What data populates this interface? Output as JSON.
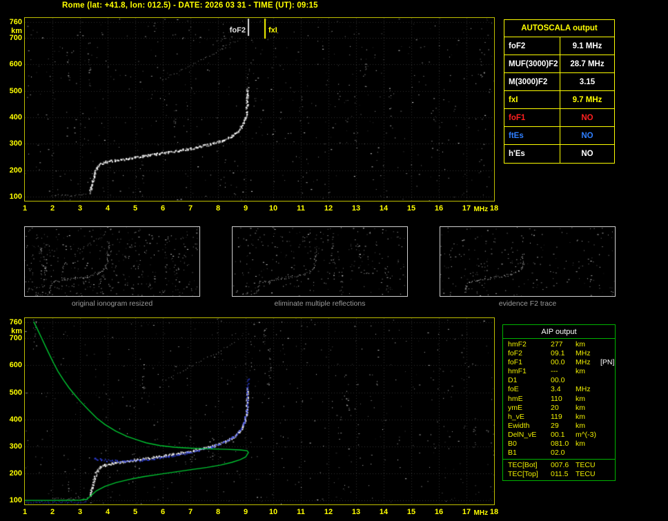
{
  "title": "Rome (lat: +41.8, lon: 012.5) - DATE: 2026 03 31 - TIME (UT): 09:15",
  "accents": {
    "title_color": "#ffff00",
    "ionogram_border": "#c0c000",
    "aip_border": "#00b400",
    "grid_color": "#343434",
    "trace_color": "#ffffff",
    "fitted_trace_color": "#3344ee",
    "profile_color": "#00c832"
  },
  "autoscala_table": {
    "header": "AUTOSCALA output",
    "rows": [
      {
        "label": "foF2",
        "value": "9.1 MHz",
        "color": "#ffffff"
      },
      {
        "label": "MUF(3000)F2",
        "value": "28.7 MHz",
        "color": "#ffffff"
      },
      {
        "label": "M(3000)F2",
        "value": "3.15",
        "color": "#ffffff"
      },
      {
        "label": "fxI",
        "value": "9.7 MHz",
        "color": "#ffff00"
      },
      {
        "label": "foF1",
        "value": "NO",
        "color": "#ff2020"
      },
      {
        "label": "ftEs",
        "value": "NO",
        "color": "#2f7fff"
      },
      {
        "label": "h'Es",
        "value": "NO",
        "color": "#ffffff"
      }
    ]
  },
  "aip_table": {
    "header": "AIP output",
    "rows": [
      {
        "label": "hmF2",
        "value": "277",
        "unit": "km",
        "extra": ""
      },
      {
        "label": "foF2",
        "value": "09.1",
        "unit": "MHz",
        "extra": ""
      },
      {
        "label": "foF1",
        "value": "00.0",
        "unit": "MHz",
        "extra": "[PN]"
      },
      {
        "label": "hmF1",
        "value": "---",
        "unit": "km",
        "extra": ""
      },
      {
        "label": "D1",
        "value": "00.0",
        "unit": "",
        "extra": ""
      },
      {
        "label": "foE",
        "value": "3.4",
        "unit": "MHz",
        "extra": ""
      },
      {
        "label": "hmE",
        "value": "110",
        "unit": "km",
        "extra": ""
      },
      {
        "label": "ymE",
        "value": "20",
        "unit": "km",
        "extra": ""
      },
      {
        "label": "h_vE",
        "value": "119",
        "unit": "km",
        "extra": ""
      },
      {
        "label": "Ewidth",
        "value": "29",
        "unit": "km",
        "extra": ""
      },
      {
        "label": "DelN_vE",
        "value": "00.1",
        "unit": "m^(-3)",
        "extra": ""
      },
      {
        "label": "B0",
        "value": "081.0",
        "unit": "km",
        "extra": ""
      },
      {
        "label": "B1",
        "value": "02.0",
        "unit": "",
        "extra": ""
      }
    ],
    "tec_rows": [
      {
        "label": "TEC[Bot]",
        "value": "007.6",
        "unit": "TECU",
        "extra": ""
      },
      {
        "label": "TEC[Top]",
        "value": "011.5",
        "unit": "TECU",
        "extra": ""
      }
    ]
  },
  "thumbnails": [
    {
      "caption": "original ionogram resized",
      "noise_count": 430,
      "streaks": 10,
      "series": [
        "E-trace",
        "F-trace",
        "second-hop",
        "x-tail"
      ]
    },
    {
      "caption": "eliminate multiple reflections",
      "noise_count": 270,
      "streaks": 7,
      "series": [
        "E-trace",
        "F-trace",
        "x-tail"
      ]
    },
    {
      "caption": "evidence F2 trace",
      "noise_count": 210,
      "streaks": 5,
      "series": [
        "F-trace"
      ]
    }
  ],
  "chart_data": [
    {
      "id": "scaled-ionogram",
      "type": "scatter",
      "title": "scaled ionogram with AUTOSCALA markers",
      "xlabel": "MHz",
      "ylabel": "km",
      "x_range": [
        1,
        18
      ],
      "y_range": [
        85,
        775
      ],
      "x_ticks": [
        1,
        2,
        3,
        4,
        5,
        6,
        7,
        8,
        9,
        10,
        11,
        12,
        13,
        14,
        15,
        16,
        17,
        18
      ],
      "y_ticks": [
        760,
        700,
        600,
        500,
        400,
        300,
        200,
        100
      ],
      "grid": true,
      "markers": [
        {
          "label": "foF2",
          "f": 9.1,
          "color": "#e0e0e0",
          "len": 26,
          "side": "left"
        },
        {
          "label": "fxI",
          "f": 9.7,
          "color": "#ffff00",
          "len": 30,
          "side": "right"
        }
      ],
      "noise": {
        "seed": 11,
        "count": 560,
        "streaks": 18
      },
      "series": [
        {
          "name": "E-trace",
          "color": "#c8c8c8",
          "size": 1,
          "density": 0.35,
          "points": [
            [
              2.0,
              107
            ],
            [
              2.5,
              106
            ],
            [
              3.0,
              108
            ],
            [
              3.3,
              112
            ]
          ]
        },
        {
          "name": "F-trace",
          "color": "#ffffff",
          "size": 2,
          "density": 0.9,
          "points": [
            [
              3.35,
              118
            ],
            [
              3.45,
              160
            ],
            [
              3.55,
              200
            ],
            [
              3.7,
              226
            ],
            [
              3.9,
              233
            ],
            [
              4.1,
              237
            ],
            [
              4.4,
              241
            ],
            [
              4.7,
              246
            ],
            [
              5.0,
              251
            ],
            [
              5.5,
              259
            ],
            [
              6.0,
              267
            ],
            [
              6.5,
              275
            ],
            [
              7.0,
              284
            ],
            [
              7.4,
              293
            ],
            [
              7.8,
              303
            ],
            [
              8.1,
              313
            ],
            [
              8.4,
              326
            ],
            [
              8.6,
              340
            ],
            [
              8.8,
              360
            ],
            [
              8.92,
              385
            ],
            [
              9.0,
              412
            ],
            [
              9.03,
              442
            ],
            [
              9.04,
              470
            ],
            [
              9.05,
              495
            ],
            [
              9.05,
              515
            ]
          ]
        },
        {
          "name": "second-hop",
          "color": "#b4b4b4",
          "size": 1,
          "density": 0.3,
          "points": [
            [
              6.0,
              545
            ],
            [
              6.4,
              565
            ],
            [
              6.8,
              586
            ],
            [
              7.2,
              608
            ],
            [
              7.6,
              630
            ],
            [
              8.0,
              652
            ],
            [
              8.3,
              670
            ],
            [
              8.6,
              688
            ],
            [
              8.8,
              700
            ]
          ]
        },
        {
          "name": "x-tail",
          "color": "#909090",
          "size": 1,
          "density": 0.2,
          "points": [
            [
              9.06,
              520
            ],
            [
              9.08,
              548
            ],
            [
              9.09,
              575
            ],
            [
              9.1,
              598
            ]
          ]
        }
      ]
    },
    {
      "id": "profile-ionogram",
      "type": "scatter",
      "title": "ionogram with fitted trace and electron density profile",
      "xlabel": "MHz",
      "ylabel": "km",
      "x_range": [
        1,
        18
      ],
      "y_range": [
        85,
        775
      ],
      "x_ticks": [
        1,
        2,
        3,
        4,
        5,
        6,
        7,
        8,
        9,
        10,
        11,
        12,
        13,
        14,
        15,
        16,
        17,
        18
      ],
      "y_ticks": [
        760,
        700,
        600,
        500,
        400,
        300,
        200,
        100
      ],
      "grid": true,
      "markers": [],
      "noise": {
        "seed": 29,
        "count": 500,
        "streaks": 15
      },
      "series": [
        {
          "name": "E-trace",
          "color": "#c8c8c8",
          "size": 1,
          "density": 0.35,
          "points": [
            [
              2.0,
              107
            ],
            [
              2.5,
              106
            ],
            [
              3.0,
              108
            ],
            [
              3.3,
              112
            ]
          ]
        },
        {
          "name": "F-trace",
          "color": "#ffffff",
          "size": 2,
          "density": 0.9,
          "points": [
            [
              3.35,
              118
            ],
            [
              3.45,
              160
            ],
            [
              3.55,
              200
            ],
            [
              3.7,
              226
            ],
            [
              3.9,
              233
            ],
            [
              4.1,
              237
            ],
            [
              4.4,
              241
            ],
            [
              4.7,
              246
            ],
            [
              5.0,
              251
            ],
            [
              5.5,
              259
            ],
            [
              6.0,
              267
            ],
            [
              6.5,
              275
            ],
            [
              7.0,
              284
            ],
            [
              7.4,
              293
            ],
            [
              7.8,
              303
            ],
            [
              8.1,
              313
            ],
            [
              8.4,
              326
            ],
            [
              8.6,
              340
            ],
            [
              8.8,
              360
            ],
            [
              8.92,
              385
            ],
            [
              9.0,
              412
            ],
            [
              9.03,
              442
            ],
            [
              9.04,
              470
            ],
            [
              9.05,
              495
            ],
            [
              9.05,
              515
            ]
          ]
        },
        {
          "name": "second-hop",
          "color": "#b4b4b4",
          "size": 1,
          "density": 0.22,
          "points": [
            [
              6.0,
              545
            ],
            [
              6.4,
              565
            ],
            [
              6.8,
              586
            ],
            [
              7.2,
              608
            ],
            [
              7.6,
              630
            ],
            [
              8.0,
              652
            ],
            [
              8.3,
              670
            ],
            [
              8.6,
              688
            ],
            [
              8.8,
              700
            ]
          ]
        },
        {
          "name": "fitted-trace",
          "color": "#3344ee",
          "size": 2,
          "density": 0.5,
          "points": [
            [
              3.5,
              258
            ],
            [
              3.8,
              251
            ],
            [
              4.1,
              248
            ],
            [
              4.5,
              246
            ],
            [
              5.0,
              248
            ],
            [
              5.5,
              254
            ],
            [
              6.0,
              262
            ],
            [
              6.5,
              271
            ],
            [
              7.0,
              281
            ],
            [
              7.4,
              291
            ],
            [
              7.8,
              302
            ],
            [
              8.1,
              313
            ],
            [
              8.4,
              327
            ],
            [
              8.6,
              341
            ],
            [
              8.8,
              362
            ],
            [
              8.93,
              390
            ],
            [
              9.0,
              418
            ],
            [
              9.03,
              448
            ],
            [
              9.05,
              478
            ],
            [
              9.06,
              505
            ],
            [
              9.06,
              530
            ],
            [
              9.07,
              555
            ]
          ]
        },
        {
          "name": "baseline",
          "color": "#3344ee",
          "size": 1,
          "density": 0.9,
          "points": [
            [
              1.0,
              93
            ],
            [
              2.0,
              93
            ],
            [
              3.0,
              94
            ],
            [
              3.2,
              98
            ],
            [
              3.3,
              106
            ]
          ]
        }
      ],
      "profile": {
        "name": "electron-density-profile",
        "color": "#00c832",
        "width": 1.4,
        "points": [
          [
            1.0,
            100
          ],
          [
            2.0,
            100
          ],
          [
            3.0,
            101
          ],
          [
            3.25,
            104
          ],
          [
            3.4,
            118
          ],
          [
            3.6,
            136
          ],
          [
            3.9,
            152
          ],
          [
            4.3,
            166
          ],
          [
            4.8,
            178
          ],
          [
            5.3,
            188
          ],
          [
            5.9,
            197
          ],
          [
            6.5,
            206
          ],
          [
            7.1,
            215
          ],
          [
            7.6,
            222
          ],
          [
            8.1,
            231
          ],
          [
            8.5,
            241
          ],
          [
            8.8,
            251
          ],
          [
            9.0,
            261
          ],
          [
            9.1,
            277
          ],
          [
            9.05,
            284
          ],
          [
            8.8,
            287
          ],
          [
            8.3,
            289
          ],
          [
            7.6,
            291
          ],
          [
            6.9,
            294
          ],
          [
            6.4,
            297
          ],
          [
            5.9,
            303
          ],
          [
            5.4,
            313
          ],
          [
            5.1,
            323
          ],
          [
            4.7,
            337
          ],
          [
            4.3,
            356
          ],
          [
            3.9,
            381
          ],
          [
            3.6,
            405
          ],
          [
            3.3,
            436
          ],
          [
            3.0,
            468
          ],
          [
            2.8,
            492
          ],
          [
            2.6,
            517
          ],
          [
            2.4,
            546
          ],
          [
            2.2,
            578
          ],
          [
            2.05,
            607
          ],
          [
            1.9,
            638
          ],
          [
            1.75,
            670
          ],
          [
            1.6,
            703
          ],
          [
            1.45,
            735
          ],
          [
            1.32,
            762
          ]
        ]
      }
    }
  ]
}
